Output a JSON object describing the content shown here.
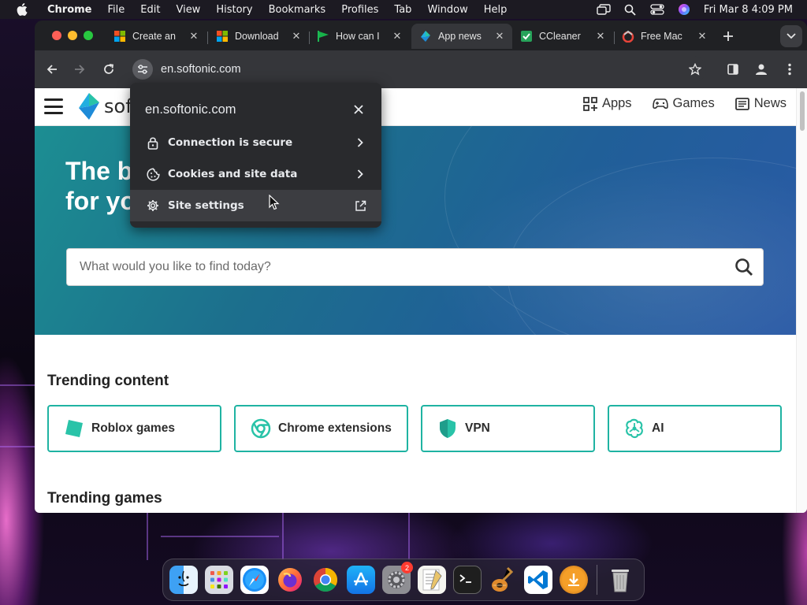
{
  "menubar": {
    "app_name": "Chrome",
    "items": [
      "File",
      "Edit",
      "View",
      "History",
      "Bookmarks",
      "Profiles",
      "Tab",
      "Window",
      "Help"
    ],
    "clock": "Fri Mar 8  4:09 PM"
  },
  "tabs": [
    {
      "title": "Create an",
      "favicon": "microsoft-icon",
      "active": false
    },
    {
      "title": "Download",
      "favicon": "microsoft-icon",
      "active": false
    },
    {
      "title": "How can I",
      "favicon": "flag-icon",
      "active": false
    },
    {
      "title": "App news",
      "favicon": "softonic-icon",
      "active": true
    },
    {
      "title": "CCleaner",
      "favicon": "ccleaner-icon",
      "active": false
    },
    {
      "title": "Free Mac",
      "favicon": "mac-apps-icon",
      "active": false
    }
  ],
  "omnibox": {
    "url": "en.softonic.com"
  },
  "site": {
    "logo_text": "sof",
    "nav": [
      {
        "label": "Apps",
        "icon": "apps-grid-icon"
      },
      {
        "label": "Games",
        "icon": "gamepad-icon"
      },
      {
        "label": "News",
        "icon": "news-icon"
      }
    ],
    "hero_title_line1": "The b",
    "hero_title_line2": "for yo",
    "search_placeholder": "What would you like to find today?",
    "trending_content_title": "Trending content",
    "trending_items": [
      {
        "label": "Roblox games",
        "icon": "roblox-icon"
      },
      {
        "label": "Chrome extensions",
        "icon": "chrome-icon"
      },
      {
        "label": "VPN",
        "icon": "shield-icon"
      },
      {
        "label": "AI",
        "icon": "ai-icon"
      }
    ],
    "trending_games_title": "Trending games"
  },
  "popup": {
    "title": "en.softonic.com",
    "rows": [
      {
        "label": "Connection is secure",
        "icon": "lock-icon",
        "trail": "chevron-right-icon"
      },
      {
        "label": "Cookies and site data",
        "icon": "cookie-icon",
        "trail": "chevron-right-icon"
      },
      {
        "label": "Site settings",
        "icon": "gear-icon",
        "trail": "external-link-icon"
      }
    ]
  },
  "dock": {
    "apps": [
      "finder",
      "launchpad",
      "safari",
      "firefox",
      "chrome",
      "app-store",
      "system-settings",
      "textedit",
      "terminal",
      "garageband",
      "vscode",
      "downloads"
    ],
    "system_settings_badge": "2"
  },
  "colors": {
    "accent_teal": "#1fb3a2",
    "hero_start": "#1c8e92",
    "hero_end": "#2a5aa6",
    "chrome_dark": "#202124",
    "popup_bg": "#292a2d"
  }
}
